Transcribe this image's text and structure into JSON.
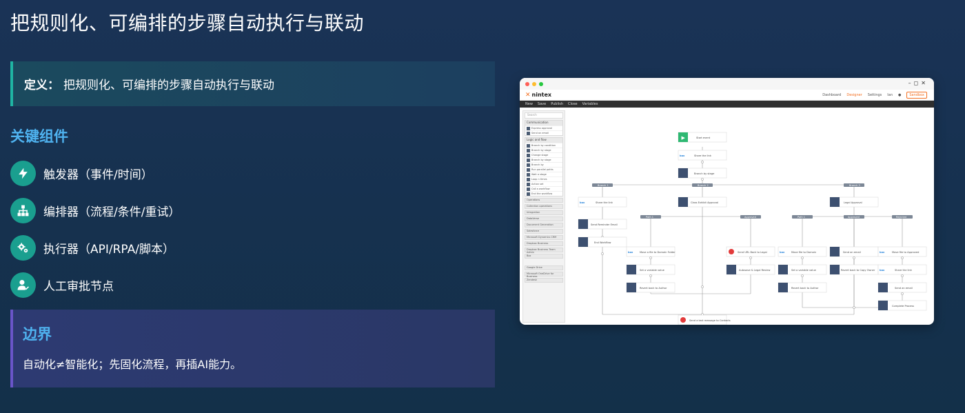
{
  "title": "把规则化、可编排的步骤自动执行与联动",
  "definition": {
    "label": "定义：",
    "text": "把规则化、可编排的步骤自动执行与联动"
  },
  "components": {
    "heading": "关键组件",
    "items": [
      {
        "label": "触发器（事件/时间）",
        "icon": "lightning-icon"
      },
      {
        "label": "编排器（流程/条件/重试）",
        "icon": "hierarchy-icon"
      },
      {
        "label": "执行器（API/RPA/脚本）",
        "icon": "gears-icon"
      },
      {
        "label": "人工审批节点",
        "icon": "user-check-icon"
      }
    ]
  },
  "boundary": {
    "heading": "边界",
    "text": "自动化≠智能化；先固化流程，再插AI能力。"
  },
  "colors": {
    "accent_teal": "#1fb5a3",
    "accent_blue": "#4fb3f0",
    "accent_purple": "#6a55c9",
    "brand_orange": "#f36f21"
  },
  "app": {
    "brand": "nintex",
    "nav": [
      "Dashboard",
      "Designer",
      "Settings"
    ],
    "user": "Ian",
    "pill": "Sandbox",
    "toolbar": [
      "New",
      "Save",
      "Publish",
      "Close",
      "Variables"
    ],
    "side": {
      "search": "Search",
      "groups": [
        {
          "name": "Communication",
          "rows": [
            "Express approval",
            "Send an email"
          ]
        },
        {
          "name": "Logic and flow",
          "rows": [
            "Branch by condition",
            "Branch by stage",
            "Change stage",
            "Branch by stage",
            "Branch by",
            "Run parallel paths",
            "Wait a stage",
            "Loop n times",
            "Action set",
            "Call a workflow",
            "End the workflow"
          ]
        }
      ],
      "bars": [
        "Operations",
        "Collection operations",
        "Integration",
        "DataVerse",
        "Document Generation",
        "Salesforce",
        "Microsoft Dynamics CRM",
        "Dropbox Business",
        "Dropbox Business Team Admin",
        "Box"
      ],
      "bars2": [
        "Google Drive",
        "Microsoft OneDrive for Business",
        "Zendesk"
      ]
    },
    "flow": {
      "nodes": {
        "start": "Start event",
        "share": "Share the link",
        "branch": "Branch by stage",
        "share_file": "Share the link",
        "send_email": "Send Reminder Email",
        "end_workflow": "End Workflow",
        "class_approval": "Class Exhibit Approval",
        "move_folder": "Move a file to Domain Folder",
        "set_var1": "Set a variable value",
        "revert1": "Revert back to Author",
        "send_url": "Send URL Back to Legal",
        "autosave": "Autosave & Legal Review",
        "legal_approval": "Legal Approval",
        "move_folder2": "Move file to Domain",
        "set_var2": "Set a variable value",
        "revert2": "Revert back to Author",
        "send_email2": "Send an email",
        "revert_copy": "Revert back to Copy Owner",
        "move_approved": "Move file to Approved",
        "share_link2": "Share the link",
        "send_email3": "Send an email",
        "complete": "Complete Process",
        "final": "Send a text message to Contacts"
      },
      "badges": [
        "Branch 1",
        "Branch 2",
        "Branch 3",
        "Path 1",
        "Approved",
        "Path 1",
        "Approved",
        "Rejected"
      ]
    }
  }
}
